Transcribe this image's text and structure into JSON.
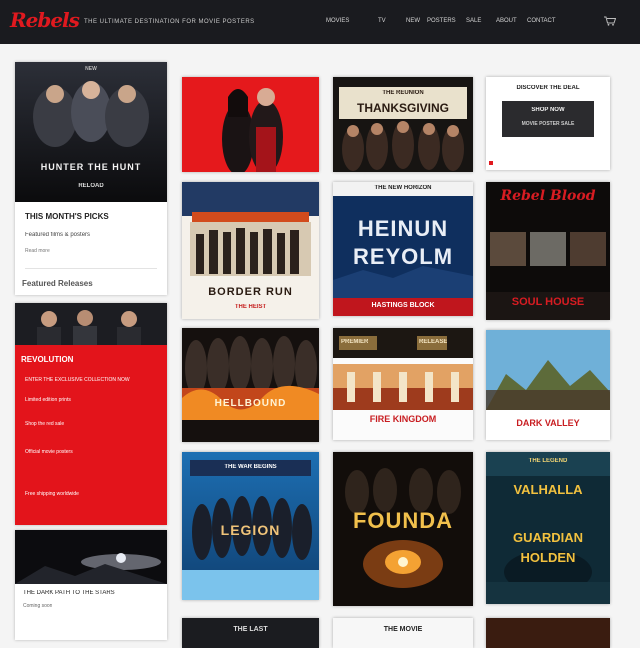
{
  "header": {
    "logo": "Rebels",
    "tagline": "THE ULTIMATE DESTINATION FOR MOVIE POSTERS",
    "nav": [
      "MOVIES",
      "TV",
      "NEW",
      "POSTERS",
      "SALE",
      "ABOUT",
      "CONTACT"
    ],
    "cart_icon": "cart-icon"
  },
  "sidebar": {
    "feature_card": {
      "poster_small_label": "NEW",
      "poster_headline": "HUNTER THE HUNT",
      "poster_sub": "RELOAD",
      "title": "THIS MONTH'S PICKS",
      "subtitle": "Featured films & posters",
      "meta": "Read more"
    },
    "section_label": "Featured Releases",
    "promo_card": {
      "headline": "REVOLUTION",
      "lines": [
        "ENTER THE EXCLUSIVE COLLECTION NOW",
        "Limited edition prints",
        "Shop the red sale",
        "Official movie posters",
        "Free shipping worldwide"
      ]
    },
    "bottom_card": {
      "line1": "THE DARK PATH TO THE STARS",
      "line2": "Coming soon"
    }
  },
  "posters": {
    "col1": [
      {
        "id": "p-red-duo",
        "title": ""
      },
      {
        "id": "p-gas-station",
        "title": "BORDER RUN",
        "subtitle": "THE HEIST"
      },
      {
        "id": "p-fire-crowd",
        "title": "HELLBOUND"
      },
      {
        "id": "p-blue-army",
        "title": "LEGION",
        "label": "THE WAR BEGINS"
      },
      {
        "id": "p-partial-1",
        "title": "THE LAST"
      }
    ],
    "col2": [
      {
        "id": "p-cast-banner",
        "top": "THE REUNION",
        "title": "THANKSGIVING"
      },
      {
        "id": "p-heinun",
        "top": "THE NEW HORIZON",
        "title1": "HEINUN",
        "title2": "REYOLM",
        "bottom": "HASTINGS BLOCK"
      },
      {
        "id": "p-palace",
        "chip1": "PREMIER",
        "chip2": "RELEASE",
        "title": "FIRE KINGDOM"
      },
      {
        "id": "p-fountain",
        "title": "FOUNDA"
      },
      {
        "id": "p-partial-2",
        "title": "THE MOVIE"
      }
    ],
    "col3": [
      {
        "id": "p-white-box",
        "line1": "DISCOVER THE DEAL",
        "line2": "SHOP NOW",
        "line3": "MOVIE POSTER SALE"
      },
      {
        "id": "p-script",
        "title": "Rebel Blood",
        "bottom": "SOUL HOUSE"
      },
      {
        "id": "p-mountain",
        "title": "DARK VALLEY"
      },
      {
        "id": "p-yellow",
        "top": "THE LEGEND",
        "title1": "VALHALLA",
        "title2": "GUARDIAN",
        "title3": "HOLDEN"
      },
      {
        "id": "p-partial-3",
        "title": ""
      }
    ]
  },
  "colors": {
    "accent_red": "#e0191f",
    "header_bg": "#1a1b1f",
    "page_bg": "#f4f4f4"
  }
}
